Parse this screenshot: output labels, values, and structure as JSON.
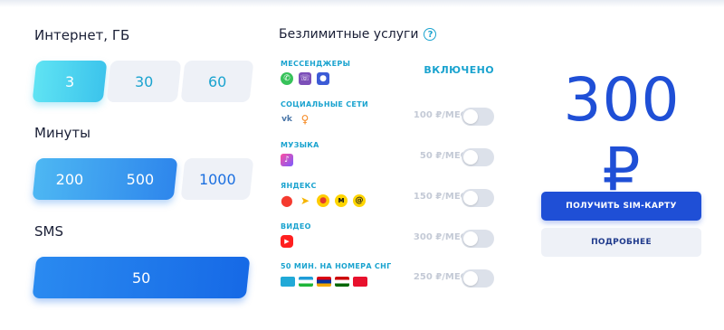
{
  "internet": {
    "title": "Интернет, ГБ",
    "options": [
      "3",
      "30",
      "60"
    ],
    "selected": "3"
  },
  "minutes": {
    "title": "Минуты",
    "options": [
      "200",
      "500",
      "1000"
    ],
    "selected": "500"
  },
  "sms": {
    "title": "SMS",
    "options": [
      "50"
    ],
    "selected": "50"
  },
  "unlimited": {
    "title": "Безлимитные услуги",
    "help_icon": "?",
    "services": [
      {
        "name": "МЕССЕНДЖЕРЫ",
        "status": "ВКЛЮЧЕНО",
        "icons": [
          "whatsapp-icon",
          "viber-icon",
          "tamtam-icon"
        ]
      },
      {
        "name": "СОЦИАЛЬНЫЕ СЕТИ",
        "price": "100 ₽/МЕС",
        "enabled": false,
        "icons": [
          "vk-icon",
          "odnoklassniki-icon"
        ]
      },
      {
        "name": "МУЗЫКА",
        "price": "50 ₽/МЕС",
        "enabled": false,
        "icons": [
          "music-icon"
        ]
      },
      {
        "name": "ЯНДЕКС",
        "price": "150 ₽/МЕС",
        "enabled": false,
        "icons": [
          "yandex-maps-icon",
          "yandex-navigator-icon",
          "yandex-music-icon",
          "yandex-market-icon",
          "yandex-mail-icon"
        ]
      },
      {
        "name": "ВИДЕО",
        "price": "300 ₽/МЕС",
        "enabled": false,
        "icons": [
          "youtube-icon"
        ]
      },
      {
        "name": "50 МИН. НА НОМЕРА СНГ",
        "price": "250 ₽/МЕС",
        "enabled": false,
        "icons": [
          "kazakhstan-flag-icon",
          "uzbekistan-flag-icon",
          "armenia-flag-icon",
          "tajikistan-flag-icon",
          "kyrgyzstan-flag-icon"
        ]
      }
    ]
  },
  "summary": {
    "price": "300 ₽",
    "get_sim_label": "ПОЛУЧИТЬ SIM-КАРТУ",
    "details_label": "ПОДРОБНЕЕ"
  },
  "colors": {
    "accent_cyan": "#1aa3cf",
    "accent_blue": "#1f4fd6",
    "muted_bg": "#eef1f7"
  }
}
